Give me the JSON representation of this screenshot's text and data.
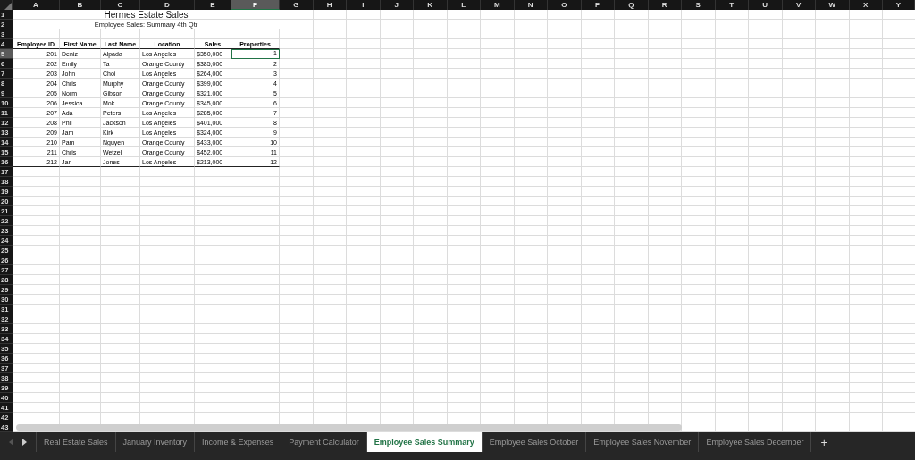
{
  "columns": [
    {
      "label": "A",
      "selected": false
    },
    {
      "label": "B",
      "selected": false
    },
    {
      "label": "C",
      "selected": false
    },
    {
      "label": "D",
      "selected": false
    },
    {
      "label": "E",
      "selected": false
    },
    {
      "label": "F",
      "selected": true
    },
    {
      "label": "G",
      "selected": false
    },
    {
      "label": "H",
      "selected": false
    },
    {
      "label": "I",
      "selected": false
    },
    {
      "label": "J",
      "selected": false
    },
    {
      "label": "K",
      "selected": false
    },
    {
      "label": "L",
      "selected": false
    },
    {
      "label": "M",
      "selected": false
    },
    {
      "label": "N",
      "selected": false
    },
    {
      "label": "O",
      "selected": false
    },
    {
      "label": "P",
      "selected": false
    },
    {
      "label": "Q",
      "selected": false
    },
    {
      "label": "R",
      "selected": false
    },
    {
      "label": "S",
      "selected": false
    },
    {
      "label": "T",
      "selected": false
    },
    {
      "label": "U",
      "selected": false
    },
    {
      "label": "V",
      "selected": false
    },
    {
      "label": "W",
      "selected": false
    },
    {
      "label": "X",
      "selected": false
    },
    {
      "label": "Y",
      "selected": false
    }
  ],
  "row_numbers": [
    {
      "label": "1",
      "selected": false
    },
    {
      "label": "2",
      "selected": false
    },
    {
      "label": "3",
      "selected": false
    },
    {
      "label": "4",
      "selected": false
    },
    {
      "label": "5",
      "selected": true
    },
    {
      "label": "6",
      "selected": false
    },
    {
      "label": "7",
      "selected": false
    },
    {
      "label": "8",
      "selected": false
    },
    {
      "label": "9",
      "selected": false
    },
    {
      "label": "10",
      "selected": false
    },
    {
      "label": "11",
      "selected": false
    },
    {
      "label": "12",
      "selected": false
    },
    {
      "label": "13",
      "selected": false
    },
    {
      "label": "14",
      "selected": false
    },
    {
      "label": "15",
      "selected": false
    },
    {
      "label": "16",
      "selected": false
    },
    {
      "label": "17",
      "selected": false
    },
    {
      "label": "18",
      "selected": false
    },
    {
      "label": "19",
      "selected": false
    },
    {
      "label": "20",
      "selected": false
    },
    {
      "label": "21",
      "selected": false
    },
    {
      "label": "22",
      "selected": false
    },
    {
      "label": "23",
      "selected": false
    },
    {
      "label": "24",
      "selected": false
    },
    {
      "label": "25",
      "selected": false
    },
    {
      "label": "26",
      "selected": false
    },
    {
      "label": "27",
      "selected": false
    },
    {
      "label": "28",
      "selected": false
    },
    {
      "label": "29",
      "selected": false
    },
    {
      "label": "30",
      "selected": false
    },
    {
      "label": "31",
      "selected": false
    },
    {
      "label": "32",
      "selected": false
    },
    {
      "label": "33",
      "selected": false
    },
    {
      "label": "34",
      "selected": false
    },
    {
      "label": "35",
      "selected": false
    },
    {
      "label": "36",
      "selected": false
    },
    {
      "label": "37",
      "selected": false
    },
    {
      "label": "38",
      "selected": false
    },
    {
      "label": "39",
      "selected": false
    },
    {
      "label": "40",
      "selected": false
    },
    {
      "label": "41",
      "selected": false
    },
    {
      "label": "42",
      "selected": false
    },
    {
      "label": "43",
      "selected": false
    }
  ],
  "sheet": {
    "title": "Hermes Estate Sales",
    "subtitle": "Employee Sales:  Summary 4th Qtr",
    "headers": [
      "Employee ID",
      "First Name",
      "Last Name",
      "Location",
      "Sales",
      "Properties"
    ],
    "rows": [
      {
        "cells": [
          "201",
          "Deniz",
          "Alpada",
          "Los Angeles",
          "$350,000",
          "1"
        ],
        "properties_selected": true
      },
      {
        "cells": [
          "202",
          "Emily",
          "Ta",
          "Orange County",
          "$385,000",
          "2"
        ],
        "properties_selected": false
      },
      {
        "cells": [
          "203",
          "John",
          "Choi",
          "Los Angeles",
          "$264,000",
          "3"
        ],
        "properties_selected": false
      },
      {
        "cells": [
          "204",
          "Chris",
          "Murphy",
          "Orange County",
          "$399,000",
          "4"
        ],
        "properties_selected": false
      },
      {
        "cells": [
          "205",
          "Norm",
          "Gibson",
          "Orange County",
          "$321,000",
          "5"
        ],
        "properties_selected": false
      },
      {
        "cells": [
          "206",
          "Jessica",
          "Mok",
          "Orange County",
          "$345,000",
          "6"
        ],
        "properties_selected": false
      },
      {
        "cells": [
          "207",
          "Ada",
          "Peters",
          "Los Angeles",
          "$285,000",
          "7"
        ],
        "properties_selected": false
      },
      {
        "cells": [
          "208",
          "Phil",
          "Jackson",
          "Los Angeles",
          "$401,000",
          "8"
        ],
        "properties_selected": false
      },
      {
        "cells": [
          "209",
          "Jam",
          "Kirk",
          "Los Angeles",
          "$324,000",
          "9"
        ],
        "properties_selected": false
      },
      {
        "cells": [
          "210",
          "Pam",
          "Nguyen",
          "Orange County",
          "$433,000",
          "10"
        ],
        "properties_selected": false
      },
      {
        "cells": [
          "211",
          "Chris",
          "Wetzel",
          "Orange County",
          "$452,000",
          "11"
        ],
        "properties_selected": false
      },
      {
        "cells": [
          "212",
          "Jan",
          "Jones",
          "Los Angeles",
          "$213,000",
          "12"
        ],
        "properties_selected": false
      }
    ]
  },
  "tabs": [
    {
      "label": "Real Estate Sales",
      "selected": false
    },
    {
      "label": "January Inventory",
      "selected": false
    },
    {
      "label": "Income & Expenses",
      "selected": false
    },
    {
      "label": "Payment Calculator",
      "selected": false
    },
    {
      "label": "Employee Sales Summary",
      "selected": true
    },
    {
      "label": "Employee Sales October",
      "selected": false
    },
    {
      "label": "Employee Sales November",
      "selected": false
    },
    {
      "label": "Employee Sales December",
      "selected": false
    }
  ],
  "add_sheet_button": "+"
}
